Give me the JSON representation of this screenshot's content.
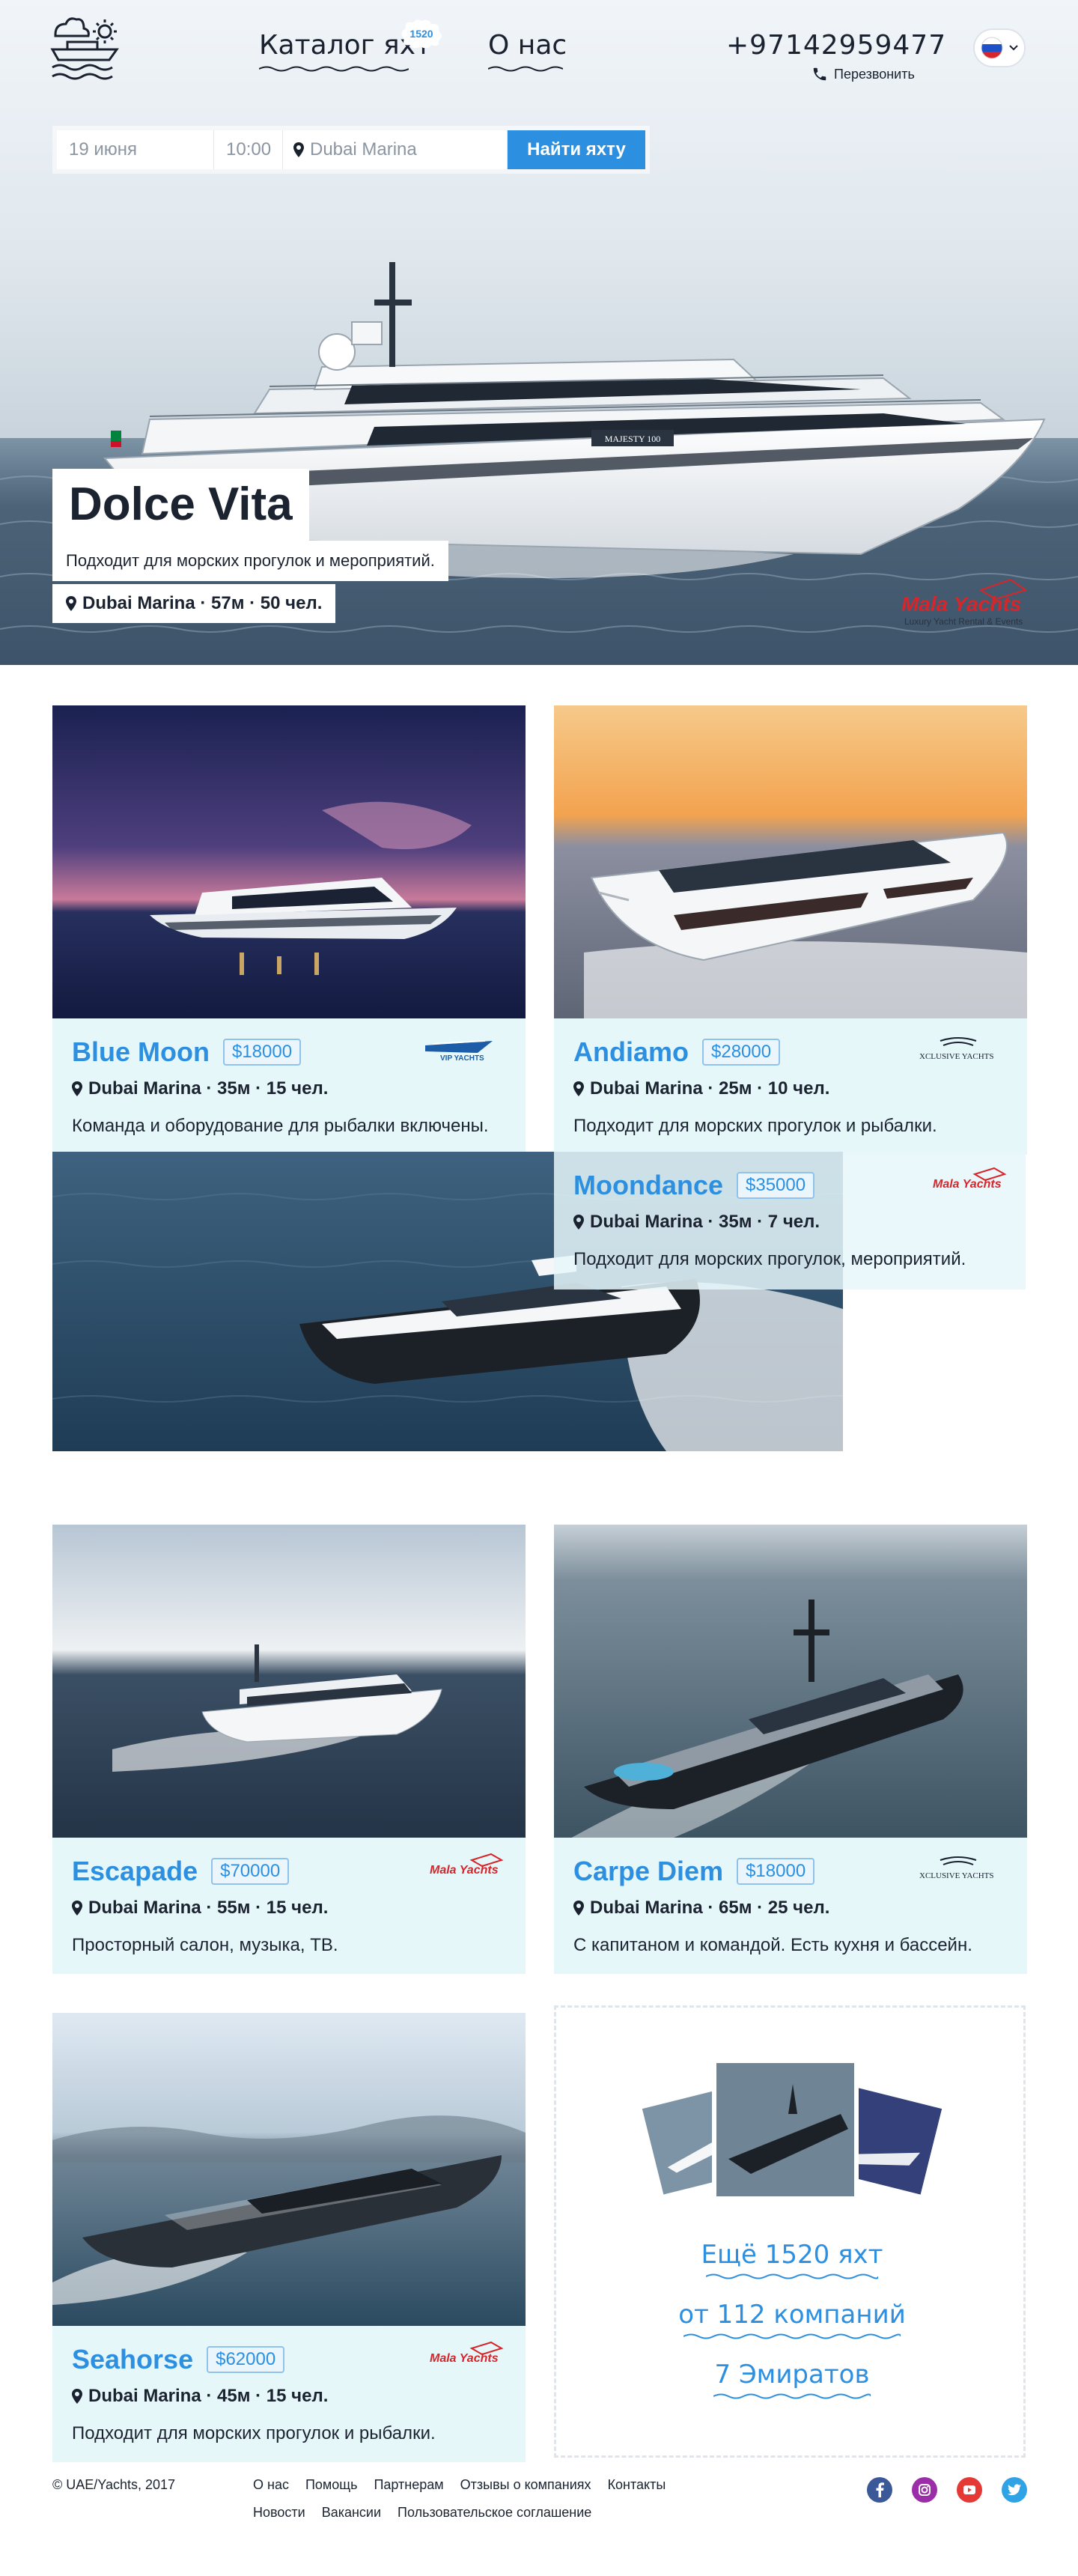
{
  "nav": {
    "catalog_label": "Каталог яхт",
    "catalog_count": "1520",
    "about_label": "О нас",
    "phone": "+97142959477",
    "callback_label": "Перезвонить",
    "language": "RU"
  },
  "search": {
    "date_value": "19 июня",
    "time_value": "10:00",
    "place_value": "Dubai Marina",
    "button_label": "Найти яхту"
  },
  "hero": {
    "title": "Dolce Vita",
    "description": "Подходит для морских прогулок и мероприятий.",
    "meta": "Dubai Marina · 57м · 50 чел.",
    "brand_name": "Mala Yachts",
    "brand_tagline": "Luxury Yacht Rental & Events",
    "boat_label": "MAJESTY 100"
  },
  "cards": [
    {
      "name": "Blue Moon",
      "price": "$18000",
      "meta": "Dubai Marina · 35м · 15 чел.",
      "description": "Команда и оборудование для рыбалки включены.",
      "brand": "VIP YACHTS"
    },
    {
      "name": "Andiamo",
      "price": "$28000",
      "meta": "Dubai Marina · 25м · 10 чел.",
      "description": "Подходит для морских прогулок и рыбалки.",
      "brand": "XCLUSIVE YACHTS"
    },
    {
      "name": "Moondance",
      "price": "$35000",
      "meta": "Dubai Marina · 35м · 7 чел.",
      "description": "Подходит для морских прогулок, мероприятий.",
      "brand": "Mala Yachts"
    },
    {
      "name": "Escapade",
      "price": "$70000",
      "meta": "Dubai Marina · 55м · 15 чел.",
      "description": "Просторный салон, музыка, ТВ.",
      "brand": "Mala Yachts"
    },
    {
      "name": "Carpe Diem",
      "price": "$18000",
      "meta": "Dubai Marina · 65м · 25 чел.",
      "description": "С капитаном и командой. Есть кухня и бассейн.",
      "brand": "XCLUSIVE YACHTS"
    },
    {
      "name": "Seahorse",
      "price": "$62000",
      "meta": "Dubai Marina · 45м · 15 чел.",
      "description": "Подходит для морских прогулок и рыбалки.",
      "brand": "Mala Yachts"
    }
  ],
  "more": {
    "yachts": "Ещё 1520 яхт",
    "companies": "от 112 компаний",
    "emirates": "7 Эмиратов"
  },
  "footer": {
    "copyright": "© UAE/Yachts, 2017",
    "links_row1": [
      "О нас",
      "Помощь",
      "Партнерам",
      "Отзывы о компаниях",
      "Контакты"
    ],
    "links_row2": [
      "Новости",
      "Вакансии",
      "Пользовательское соглашение"
    ],
    "social": [
      "facebook-icon",
      "instagram-icon",
      "youtube-icon",
      "twitter-icon"
    ]
  },
  "colors": {
    "accent": "#2d8fe0",
    "card_bg": "#e6f7fa",
    "text": "#1b2330"
  }
}
